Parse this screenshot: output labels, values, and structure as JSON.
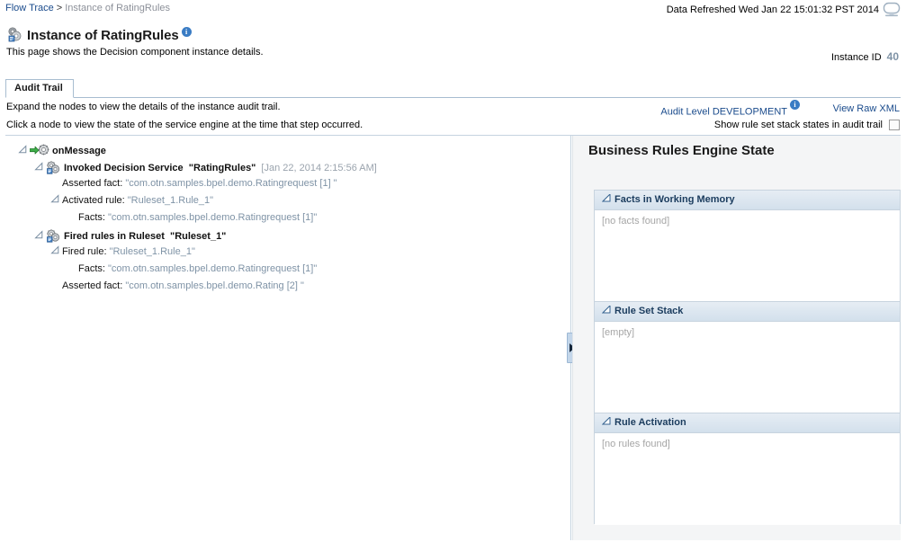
{
  "breadcrumb": {
    "root": "Flow Trace",
    "separator": ">",
    "current": "Instance of RatingRules"
  },
  "header": {
    "refreshed": "Data Refreshed Wed Jan 22 15:01:32 PST 2014",
    "monitor_icon": "monitor-icon",
    "title": "Instance of RatingRules",
    "title_icon": "decision-service-icon",
    "info_icon": "info-icon",
    "subtitle": "This page shows the Decision component instance details.",
    "instance_id_label": "Instance ID",
    "instance_id_value": "40"
  },
  "tabs": [
    {
      "label": "Audit Trail",
      "selected": true
    }
  ],
  "instructions": {
    "line1": "Expand the nodes to view the details of the instance audit trail.",
    "line2": "Click a node to view the state of the service engine at the time that step occurred."
  },
  "toolbar": {
    "audit_level_label": "Audit Level",
    "audit_level_value": "DEVELOPMENT",
    "view_raw_xml": "View Raw XML",
    "show_rule_set_stack_label": "Show rule set stack states in audit trail",
    "show_rule_set_stack_checked": false
  },
  "tree": [
    {
      "indent": 0,
      "twisty": "expanded",
      "icon": "onmessage-icon",
      "label": "onMessage",
      "bold": true,
      "value": "",
      "timestamp": ""
    },
    {
      "indent": 1,
      "twisty": "expanded",
      "icon": "decision-service-icon",
      "label": "Invoked Decision Service",
      "bold": true,
      "value": "\"RatingRules\"",
      "timestamp": "[Jan 22, 2014 2:15:56 AM]"
    },
    {
      "indent": 2,
      "twisty": "none",
      "icon": "",
      "label": "Asserted fact:",
      "bold": false,
      "value": "\"com.otn.samples.bpel.demo.Ratingrequest [1] \"",
      "timestamp": ""
    },
    {
      "indent": 2,
      "twisty": "expanded",
      "icon": "",
      "label": "Activated rule:",
      "bold": false,
      "value": "\"Ruleset_1.Rule_1\"",
      "timestamp": ""
    },
    {
      "indent": 3,
      "twisty": "none",
      "icon": "",
      "label": "Facts:",
      "bold": false,
      "value": "\"com.otn.samples.bpel.demo.Ratingrequest [1]\"",
      "timestamp": ""
    },
    {
      "indent": 1,
      "twisty": "expanded",
      "icon": "decision-service-icon",
      "label": "Fired rules in Ruleset",
      "bold": true,
      "value": "\"Ruleset_1\"",
      "timestamp": ""
    },
    {
      "indent": 2,
      "twisty": "expanded",
      "icon": "",
      "label": "Fired rule:",
      "bold": false,
      "value": "\"Ruleset_1.Rule_1\"",
      "timestamp": ""
    },
    {
      "indent": 3,
      "twisty": "none",
      "icon": "",
      "label": "Facts:",
      "bold": false,
      "value": "\"com.otn.samples.bpel.demo.Ratingrequest [1]\"",
      "timestamp": ""
    },
    {
      "indent": 2,
      "twisty": "none",
      "icon": "",
      "label": "Asserted fact:",
      "bold": false,
      "value": "\"com.otn.samples.bpel.demo.Rating [2] \"",
      "timestamp": ""
    }
  ],
  "splitter": {
    "icon": "collapse-right-arrow-icon"
  },
  "right_pane": {
    "title": "Business Rules Engine State",
    "panels": [
      {
        "title": "Facts in Working Memory",
        "empty_text": "[no facts found]"
      },
      {
        "title": "Rule Set Stack",
        "empty_text": "[empty]"
      },
      {
        "title": "Rule Activation",
        "empty_text": "[no rules found]"
      }
    ]
  },
  "colors": {
    "link": "#1a4b8c",
    "value_text": "#7f93a6",
    "timestamp_text": "#9aa3ad",
    "panel_header_bg": "#d3e0ec",
    "panel_border": "#c8d4df",
    "right_pane_bg": "#f4f5f6",
    "splitter_bg": "#c3d6ea"
  }
}
